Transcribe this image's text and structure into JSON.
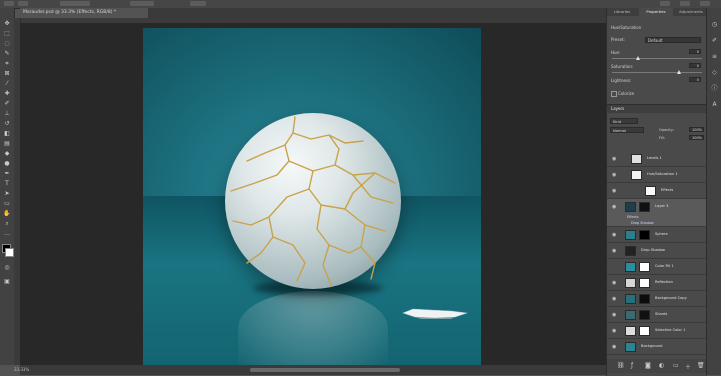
{
  "document_tab": {
    "label": "Marauder.psd @ 33.3% (Effects, RGB/8) *"
  },
  "status_bar": {
    "zoom": "33.33%"
  },
  "properties_panel": {
    "tabs": [
      "Libraries",
      "Properties",
      "Adjustments"
    ],
    "title": "Hue/Saturation",
    "preset_label": "Preset:",
    "preset_value": "Default",
    "rows": [
      {
        "label": "Hue:",
        "value": "0"
      },
      {
        "label": "Saturation:",
        "value": "0"
      },
      {
        "label": "Lightness:",
        "value": "0"
      }
    ],
    "colorize_label": "Colorize"
  },
  "layers_panel": {
    "title": "Layers",
    "kind_label": "Kind",
    "blend_mode": "Normal",
    "opacity_label": "Opacity:",
    "opacity_value": "100%",
    "fill_label": "Fill:",
    "fill_value": "100%",
    "layers": [
      {
        "name": "Levels 1",
        "visible": true
      },
      {
        "name": "Hue/Saturation 1",
        "visible": true
      },
      {
        "name": "Effects",
        "visible": true
      },
      {
        "name": "Layer 3",
        "visible": true
      },
      {
        "name": "Sphere",
        "visible": true
      },
      {
        "name": "Drop Shadow",
        "visible": true
      },
      {
        "name": "Color Fill 1",
        "visible": false
      },
      {
        "name": "Reflection",
        "visible": true
      },
      {
        "name": "Background Copy",
        "visible": true
      },
      {
        "name": "Shards",
        "visible": true
      },
      {
        "name": "Selective Color 1",
        "visible": true
      },
      {
        "name": "Background",
        "visible": true
      }
    ],
    "effects_sub": [
      "Effects",
      "Drop Shadow"
    ]
  }
}
